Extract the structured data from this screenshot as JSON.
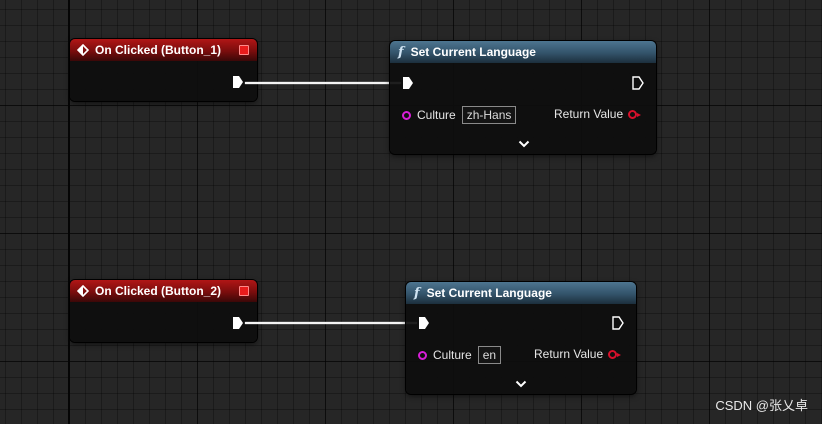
{
  "nodes": {
    "event_1": {
      "title": "On Clicked (Button_1)"
    },
    "event_2": {
      "title": "On Clicked (Button_2)"
    },
    "func_1": {
      "title": "Set Current Language",
      "culture_label": "Culture",
      "culture_value": "zh-Hans",
      "return_label": "Return Value"
    },
    "func_2": {
      "title": "Set Current Language",
      "culture_label": "Culture",
      "culture_value": "en",
      "return_label": "Return Value"
    }
  },
  "watermark": "CSDN @张乂卓",
  "colors": {
    "event_header": "#b11616",
    "function_header": "#4d7590",
    "string_pin": "#d81ed8",
    "bool_pin": "#d8102b",
    "exec_wire": "#f4f4f4"
  }
}
